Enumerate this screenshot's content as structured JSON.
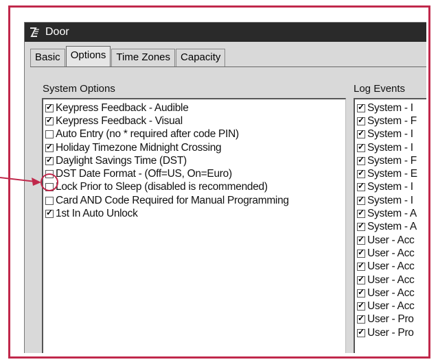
{
  "window": {
    "title": "Door"
  },
  "tabs": [
    {
      "label": "Basic",
      "active": false
    },
    {
      "label": "Options",
      "active": true
    },
    {
      "label": "Time Zones",
      "active": false
    },
    {
      "label": "Capacity",
      "active": false
    }
  ],
  "system_options": {
    "label": "System Options",
    "items": [
      {
        "label": "Keypress Feedback - Audible",
        "checked": true
      },
      {
        "label": "Keypress Feedback - Visual",
        "checked": true
      },
      {
        "label": "Auto Entry (no * required after code PIN)",
        "checked": false
      },
      {
        "label": "Holiday Timezone Midnight Crossing",
        "checked": true
      },
      {
        "label": "Daylight Savings Time (DST)",
        "checked": true
      },
      {
        "label": "DST Date Format - (Off=US, On=Euro)",
        "checked": false
      },
      {
        "label": "Lock Prior to Sleep (disabled is recommended)",
        "checked": false
      },
      {
        "label": "Card AND Code Required for Manual Programming",
        "checked": false
      },
      {
        "label": "1st In Auto Unlock",
        "checked": true
      }
    ]
  },
  "log_events": {
    "label": "Log Events",
    "items": [
      {
        "label": "System - I",
        "checked": true
      },
      {
        "label": "System - F",
        "checked": true
      },
      {
        "label": "System - I",
        "checked": true
      },
      {
        "label": "System - I",
        "checked": true
      },
      {
        "label": "System - F",
        "checked": true
      },
      {
        "label": "System - E",
        "checked": true
      },
      {
        "label": "System - I",
        "checked": true
      },
      {
        "label": "System - I",
        "checked": true
      },
      {
        "label": "System - A",
        "checked": true
      },
      {
        "label": "System - A",
        "checked": true
      },
      {
        "label": "User - Acc",
        "checked": true
      },
      {
        "label": "User - Acc",
        "checked": true
      },
      {
        "label": "User - Acc",
        "checked": true
      },
      {
        "label": "User - Acc",
        "checked": true
      },
      {
        "label": "User - Acc",
        "checked": true
      },
      {
        "label": "User - Acc",
        "checked": true
      },
      {
        "label": "User - Pro",
        "checked": true
      },
      {
        "label": "User - Pro",
        "checked": true
      }
    ]
  },
  "colors": {
    "annotation": "#c0284b",
    "titlebar": "#2a2a2a",
    "window_bg": "#d9d9d9"
  }
}
